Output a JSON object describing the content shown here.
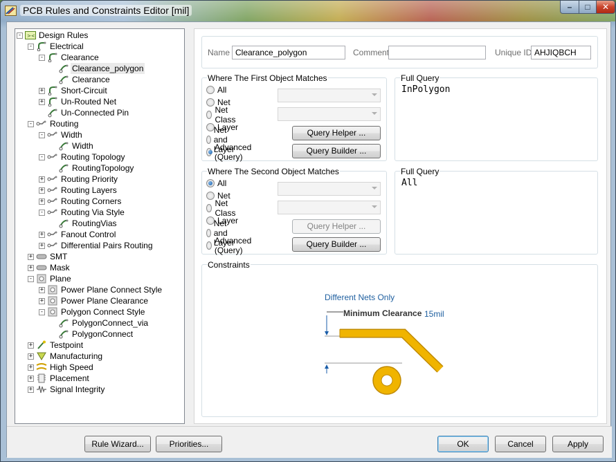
{
  "window": {
    "title": "PCB Rules and Constraints Editor [mil]",
    "controls": {
      "minimize": "–",
      "maximize": "□",
      "close": "✕"
    }
  },
  "tree": {
    "items": [
      {
        "label": "Design Rules",
        "level": 0,
        "expander": "−",
        "icon": "design-rules-icon"
      },
      {
        "label": "Electrical",
        "level": 1,
        "expander": "−",
        "icon": "electrical-icon"
      },
      {
        "label": "Clearance",
        "level": 2,
        "expander": "−",
        "icon": "clearance-icon"
      },
      {
        "label": "Clearance_polygon",
        "level": 3,
        "expander": "",
        "icon": "clearance-rule-icon",
        "selected": true
      },
      {
        "label": "Clearance",
        "level": 3,
        "expander": "",
        "icon": "clearance-rule-icon"
      },
      {
        "label": "Short-Circuit",
        "level": 2,
        "expander": "+",
        "icon": "short-circuit-icon"
      },
      {
        "label": "Un-Routed Net",
        "level": 2,
        "expander": "+",
        "icon": "unrouted-net-icon"
      },
      {
        "label": "Un-Connected Pin",
        "level": 2,
        "expander": "",
        "icon": "unconnected-pin-icon"
      },
      {
        "label": "Routing",
        "level": 1,
        "expander": "−",
        "icon": "routing-icon"
      },
      {
        "label": "Width",
        "level": 2,
        "expander": "−",
        "icon": "width-icon"
      },
      {
        "label": "Width",
        "level": 3,
        "expander": "",
        "icon": "width-rule-icon"
      },
      {
        "label": "Routing Topology",
        "level": 2,
        "expander": "−",
        "icon": "topology-icon"
      },
      {
        "label": "RoutingTopology",
        "level": 3,
        "expander": "",
        "icon": "topology-rule-icon"
      },
      {
        "label": "Routing Priority",
        "level": 2,
        "expander": "+",
        "icon": "priority-icon"
      },
      {
        "label": "Routing Layers",
        "level": 2,
        "expander": "+",
        "icon": "layers-icon"
      },
      {
        "label": "Routing Corners",
        "level": 2,
        "expander": "+",
        "icon": "corners-icon"
      },
      {
        "label": "Routing Via Style",
        "level": 2,
        "expander": "−",
        "icon": "via-style-icon"
      },
      {
        "label": "RoutingVias",
        "level": 3,
        "expander": "",
        "icon": "via-rule-icon"
      },
      {
        "label": "Fanout Control",
        "level": 2,
        "expander": "+",
        "icon": "fanout-icon"
      },
      {
        "label": "Differential Pairs Routing",
        "level": 2,
        "expander": "+",
        "icon": "diff-pairs-icon"
      },
      {
        "label": "SMT",
        "level": 1,
        "expander": "+",
        "icon": "smt-icon"
      },
      {
        "label": "Mask",
        "level": 1,
        "expander": "+",
        "icon": "mask-icon"
      },
      {
        "label": "Plane",
        "level": 1,
        "expander": "−",
        "icon": "plane-icon"
      },
      {
        "label": "Power Plane Connect Style",
        "level": 2,
        "expander": "+",
        "icon": "plane-connect-icon"
      },
      {
        "label": "Power Plane Clearance",
        "level": 2,
        "expander": "+",
        "icon": "plane-clearance-icon"
      },
      {
        "label": "Polygon Connect Style",
        "level": 2,
        "expander": "−",
        "icon": "polygon-connect-icon"
      },
      {
        "label": "PolygonConnect_via",
        "level": 3,
        "expander": "",
        "icon": "polygon-rule-icon"
      },
      {
        "label": "PolygonConnect",
        "level": 3,
        "expander": "",
        "icon": "polygon-rule-icon"
      },
      {
        "label": "Testpoint",
        "level": 1,
        "expander": "+",
        "icon": "testpoint-icon"
      },
      {
        "label": "Manufacturing",
        "level": 1,
        "expander": "+",
        "icon": "manufacturing-icon"
      },
      {
        "label": "High Speed",
        "level": 1,
        "expander": "+",
        "icon": "high-speed-icon"
      },
      {
        "label": "Placement",
        "level": 1,
        "expander": "+",
        "icon": "placement-icon"
      },
      {
        "label": "Signal Integrity",
        "level": 1,
        "expander": "+",
        "icon": "signal-integrity-icon"
      }
    ]
  },
  "rule": {
    "name_label": "Name",
    "name_value": "Clearance_polygon",
    "comment_label": "Comment",
    "comment_value": "",
    "uid_label": "Unique ID",
    "uid_value": "AHJIQBCH"
  },
  "first_match": {
    "title": "Where The First Object Matches",
    "options": [
      "All",
      "Net",
      "Net Class",
      "Layer",
      "Net and Layer",
      "Advanced (Query)"
    ],
    "selected": "Advanced (Query)",
    "query_helper": "Query Helper ...",
    "query_builder": "Query Builder ...",
    "full_query_title": "Full Query",
    "full_query": "InPolygon"
  },
  "second_match": {
    "title": "Where The Second Object Matches",
    "options": [
      "All",
      "Net",
      "Net Class",
      "Layer",
      "Net and Layer",
      "Advanced (Query)"
    ],
    "selected": "All",
    "query_helper": "Query Helper ...",
    "query_builder": "Query Builder ...",
    "full_query_title": "Full Query",
    "full_query": "All"
  },
  "constraints": {
    "title": "Constraints",
    "net_scope": "Different Nets Only",
    "min_clearance_label": "Minimum Clearance",
    "min_clearance_value": "15mil",
    "colors": {
      "copper": "#f0b400",
      "copper_edge": "#c08a00",
      "accent_text": "#2060a0"
    }
  },
  "footer": {
    "rule_wizard": "Rule Wizard...",
    "priorities": "Priorities...",
    "ok": "OK",
    "cancel": "Cancel",
    "apply": "Apply"
  }
}
